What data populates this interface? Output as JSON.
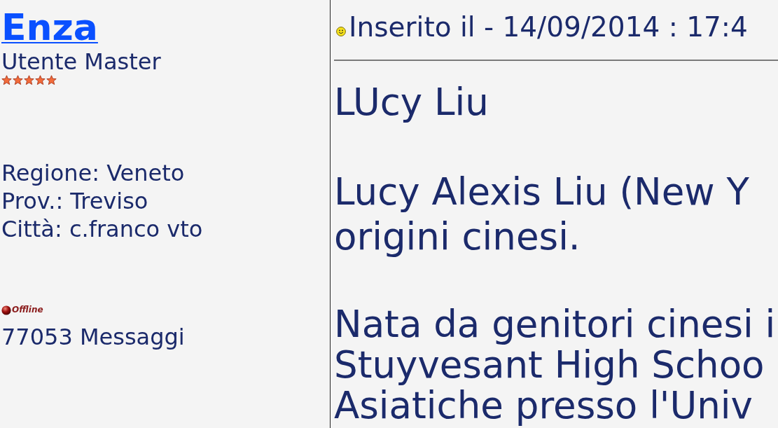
{
  "author": {
    "name": "Enza",
    "rank": "Utente Master",
    "stars": 5,
    "details": [
      "Regione: Veneto",
      "Prov.: Treviso",
      "Città: c.franco vto"
    ],
    "status": {
      "online": false,
      "label": "Offline"
    },
    "posts": "77053 Messaggi"
  },
  "post": {
    "timestamp": "Inserito il - 14/09/2014 : 17:4",
    "paragraphs": [
      {
        "lines": [
          "LUcy Liu"
        ]
      },
      {
        "lines": [
          "Lucy Alexis Liu (New Y",
          "origini cinesi."
        ]
      },
      {
        "lines": [
          "Nata da genitori cinesi i",
          "Stuyvesant High Schoo",
          "Asiatiche presso l'Univ"
        ]
      }
    ]
  }
}
